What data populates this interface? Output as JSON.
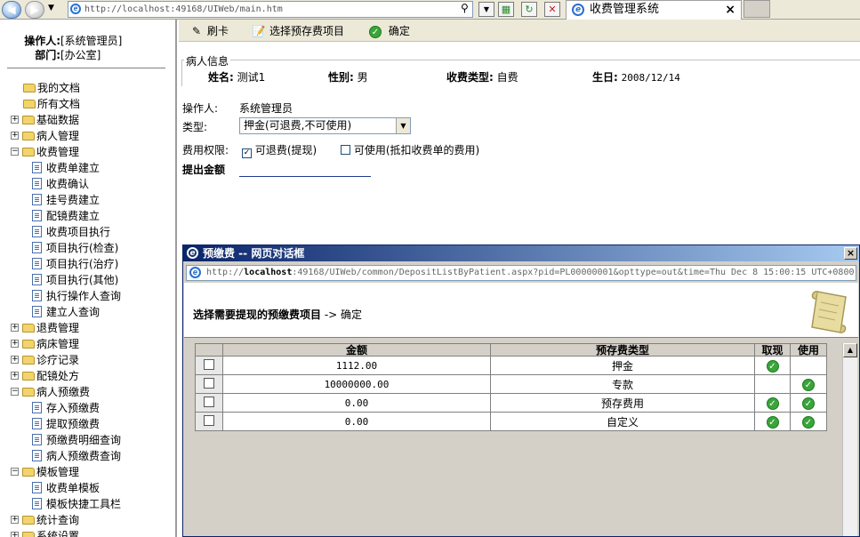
{
  "browser": {
    "address": "http://localhost:49168/UIWeb/main.htm",
    "tab_title": "收费管理系统",
    "tab_close": "×"
  },
  "operator": {
    "operator_label": "操作人:",
    "operator_value": "[系统管理员]",
    "dept_label": "部门:",
    "dept_value": "[办公室]"
  },
  "tree": [
    {
      "label": "我的文档",
      "level": 1,
      "icon": "doc-star-icon"
    },
    {
      "label": "所有文档",
      "level": 1,
      "icon": "folder-icon"
    },
    {
      "label": "基础数据",
      "level": 0,
      "icon": "folder-icon",
      "exp": "+"
    },
    {
      "label": "病人管理",
      "level": 0,
      "icon": "folder-icon",
      "exp": "+"
    },
    {
      "label": "收费管理",
      "level": 0,
      "icon": "folder-icon",
      "exp": "-"
    },
    {
      "label": "收费单建立",
      "level": 2,
      "icon": "doc-icon"
    },
    {
      "label": "收费确认",
      "level": 2,
      "icon": "doc-icon"
    },
    {
      "label": "挂号费建立",
      "level": 2,
      "icon": "doc-icon"
    },
    {
      "label": "配镜费建立",
      "level": 2,
      "icon": "doc-icon"
    },
    {
      "label": "收费项目执行",
      "level": 2,
      "icon": "doc-icon"
    },
    {
      "label": "项目执行(检查)",
      "level": 2,
      "icon": "doc-icon"
    },
    {
      "label": "项目执行(治疗)",
      "level": 2,
      "icon": "doc-icon"
    },
    {
      "label": "项目执行(其他)",
      "level": 2,
      "icon": "doc-icon"
    },
    {
      "label": "执行操作人查询",
      "level": 2,
      "icon": "doc-icon"
    },
    {
      "label": "建立人查询",
      "level": 2,
      "icon": "doc-icon"
    },
    {
      "label": "退费管理",
      "level": 0,
      "icon": "folder-icon",
      "exp": "+"
    },
    {
      "label": "病床管理",
      "level": 0,
      "icon": "folder-icon",
      "exp": "+"
    },
    {
      "label": "诊疗记录",
      "level": 0,
      "icon": "folder-icon",
      "exp": "+"
    },
    {
      "label": "配镜处方",
      "level": 0,
      "icon": "folder-icon",
      "exp": "+"
    },
    {
      "label": "病人预缴费",
      "level": 0,
      "icon": "folder-icon",
      "exp": "-"
    },
    {
      "label": "存入预缴费",
      "level": 2,
      "icon": "doc-icon"
    },
    {
      "label": "提取预缴费",
      "level": 2,
      "icon": "doc-icon"
    },
    {
      "label": "预缴费明细查询",
      "level": 2,
      "icon": "doc-icon"
    },
    {
      "label": "病人预缴费查询",
      "level": 2,
      "icon": "doc-icon"
    },
    {
      "label": "模板管理",
      "level": 0,
      "icon": "folder-icon",
      "exp": "-"
    },
    {
      "label": "收费单模板",
      "level": 2,
      "icon": "doc-icon"
    },
    {
      "label": "模板快捷工具栏",
      "level": 2,
      "icon": "doc-icon"
    },
    {
      "label": "统计查询",
      "level": 0,
      "icon": "folder-icon",
      "exp": "+"
    },
    {
      "label": "系统设置",
      "level": 0,
      "icon": "folder-icon",
      "exp": "+"
    }
  ],
  "toolbar": {
    "swipe_card": "刷卡",
    "select_deposit": "选择预存费项目",
    "confirm": "确定"
  },
  "patient": {
    "legend": "病人信息",
    "name_label": "姓名:",
    "name_value": "测试1",
    "gender_label": "性别:",
    "gender_value": "男",
    "fee_type_label": "收费类型:",
    "fee_type_value": "自费",
    "birthday_label": "生日:",
    "birthday_value": "2008/12/14"
  },
  "form": {
    "operator_label": "操作人:",
    "operator_value": "系统管理员",
    "type_label": "类型:",
    "type_value": "押金(可退费,不可使用)",
    "perm_label": "费用权限:",
    "perm_refund_label": "可退费(提现)",
    "perm_refund_checked": true,
    "perm_use_label": "可使用(抵扣收费单的费用)",
    "perm_use_checked": false,
    "amount_label": "提出金额"
  },
  "dialog": {
    "title": "预缴费 -- 网页对话框",
    "close": "×",
    "url_prefix": "http://",
    "url_host": "localhost",
    "url_rest": ":49168/UIWeb/common/DepositListByPatient.aspx?pid=PL00000001&opttype=out&time=Thu Dec 8 15:00:15 UTC+0800",
    "instruction": "选择需要提现的预缴费项目",
    "instruction_arrow": " -> 确定",
    "table": {
      "headers": [
        "",
        "金额",
        "预存费类型",
        "取现",
        "使用"
      ],
      "rows": [
        {
          "amount": "1112.00",
          "type": "押金",
          "withdraw": true,
          "use": false
        },
        {
          "amount": "10000000.00",
          "type": "专款",
          "withdraw": false,
          "use": true
        },
        {
          "amount": "0.00",
          "type": "预存费用",
          "withdraw": true,
          "use": true
        },
        {
          "amount": "0.00",
          "type": "自定义",
          "withdraw": true,
          "use": true
        }
      ]
    }
  },
  "colors": {
    "dialog_title_start": "#0a246a",
    "check_green": "#3aa53a",
    "chrome_bg": "#ece9d8"
  }
}
